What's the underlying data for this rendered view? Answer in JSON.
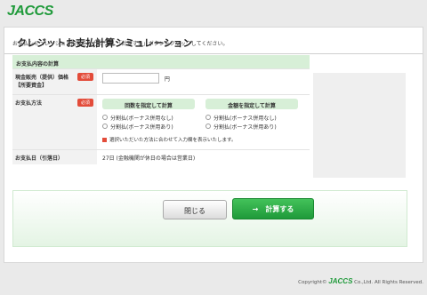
{
  "header": {
    "logo_text": "JACCS"
  },
  "page": {
    "title": "クレジットお支払計算シミュレーション",
    "intro": "お支払シミュレーション内容を入力のうえ、「計算する」ボタンをクリックしてください。"
  },
  "form": {
    "section_title": "お支払内容の計算",
    "required_badge": "必須",
    "price": {
      "label_line1": "現金販売（提供）価格",
      "label_line2": "【所要資金】",
      "value": "",
      "unit": "円"
    },
    "method": {
      "label": "お支払方法",
      "col1_head": "回数を指定して計算",
      "col2_head": "金額を指定して計算",
      "option_no_bonus": "分割払(ボーナス併用なし)",
      "option_bonus": "分割払(ボーナス併用あり)",
      "note": "選択いただいた方法に合わせて入力欄を表示いたします。"
    },
    "date": {
      "label": "お支払日（引落日）",
      "value": "27日 (金融機関が休日の場合は営業日)"
    }
  },
  "buttons": {
    "close": "閉じる",
    "calculate": "→　計算する"
  },
  "footer": {
    "copyright_prefix": "Copyright©",
    "logo": "JACCS",
    "suffix": "Co.,Ltd. All Rights Reserved."
  },
  "colors": {
    "brand_green": "#1f9a3a",
    "section_green": "#d7efd7",
    "required_red": "#e34c3a"
  }
}
